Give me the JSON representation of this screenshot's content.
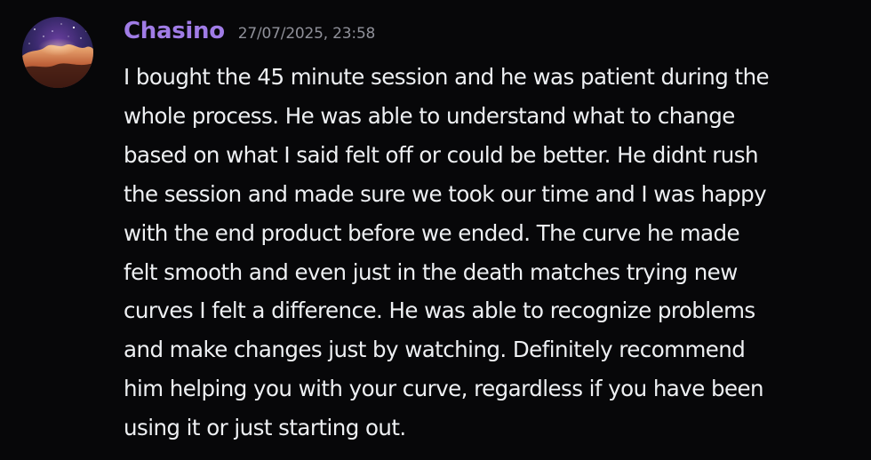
{
  "message": {
    "author": {
      "username": "Chasino",
      "username_color": "#a07ce6"
    },
    "timestamp": "27/07/2025, 23:58",
    "content_lines": [
      "I bought the 45 minute session and he was patient during the",
      "whole process. He was able to understand what to change",
      "based on what I said felt off or could be better. He didnt rush",
      "the session and made sure we took our time and I was happy",
      "with the end product before we ended. The curve he made",
      "felt smooth and even just in the death matches trying new",
      "curves I felt a difference. He was able to recognize problems",
      "and make changes just by watching. Definitely recommend",
      "him helping you with your curve, regardless if you have been",
      "using it or just starting out."
    ]
  },
  "colors": {
    "background": "#070709",
    "text": "#eef0f3",
    "timestamp": "#8f9099"
  },
  "icons": {
    "avatar": "nebula-space-image-avatar"
  }
}
